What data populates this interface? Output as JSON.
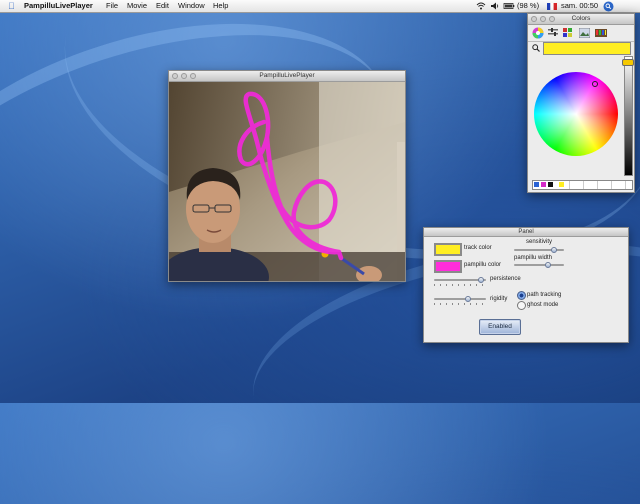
{
  "menubar": {
    "app_name": "PampilluLivePlayer",
    "menus": [
      "File",
      "Movie",
      "Edit",
      "Window",
      "Help"
    ],
    "battery": "(98 %)",
    "clock": "sam. 00:50"
  },
  "player": {
    "title": "PampilluLivePlayer"
  },
  "colors": {
    "title": "Colors",
    "current_color": "#ffee22"
  },
  "panel": {
    "title": "Panel",
    "track_color_label": "track color",
    "track_color": "#ffee22",
    "pampillu_color_label": "pampillu color",
    "pampillu_color": "#ff2ddb",
    "sensitivity_label": "sensitivity",
    "sensitivity": 0.85,
    "pampillu_width_label": "pampillu width",
    "pampillu_width": 0.7,
    "persistence_label": "persistence",
    "persistence": 0.95,
    "rigidity_label": "rigidity",
    "rigidity": 0.68,
    "path_tracking_label": "path tracking",
    "ghost_mode_label": "ghost mode",
    "enabled_label": "Enabled"
  }
}
